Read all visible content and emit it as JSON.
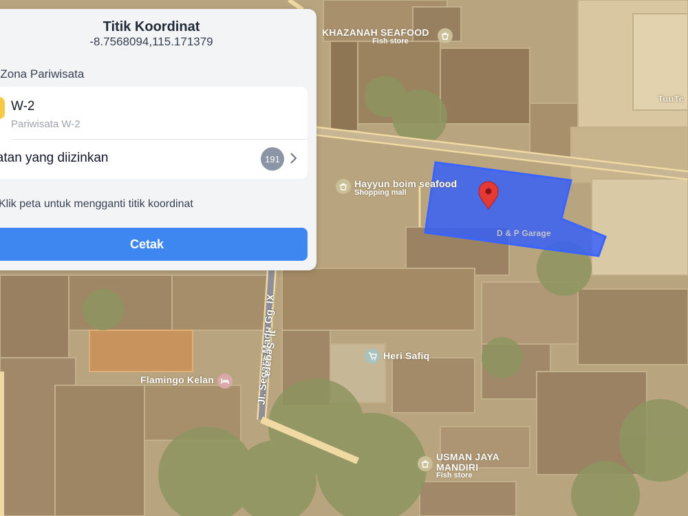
{
  "panel": {
    "title": "Titik Koordinat",
    "coordinates": "-8.7568094,115.171379",
    "zone_heading": "- Zona Pariwisata",
    "zone": {
      "code": "W-2",
      "name": "Pariwisata W-2",
      "color": "#f7c948"
    },
    "activities": {
      "label": "giatan yang diizinkan",
      "count": "191"
    },
    "hint": "Klik peta untuk mengganti titik koordinat",
    "print_label": "Cetak",
    "accent_color": "#3f87f0"
  },
  "map": {
    "pois": [
      {
        "name": "KHAZANAH SEAFOOD",
        "category": "Fish store",
        "icon": "shopping-bag-icon"
      },
      {
        "name": "Hayyun boim seafood",
        "category": "Shopping mall",
        "icon": "shopping-bag-icon"
      },
      {
        "name": "Heri Safiq",
        "category": "",
        "icon": "shopping-cart-icon"
      },
      {
        "name": "Flamingo Kelan",
        "category": "",
        "icon": "hotel-icon"
      },
      {
        "name": "USMAN JAYA MANDIRI",
        "name_line2": "MANDIRI",
        "category": "Fish store",
        "icon": "shopping-bag-icon"
      },
      {
        "name": "D & P Garage",
        "category": "",
        "icon": ""
      },
      {
        "name": "TuuTe",
        "category": "",
        "icon": ""
      }
    ],
    "roads": {
      "gg1": "Jl. Segara Madu Gg. IX",
      "gg2": "Jl. Segara"
    },
    "polygon_color": "#2f5dff",
    "marker_color": "#e53935"
  }
}
